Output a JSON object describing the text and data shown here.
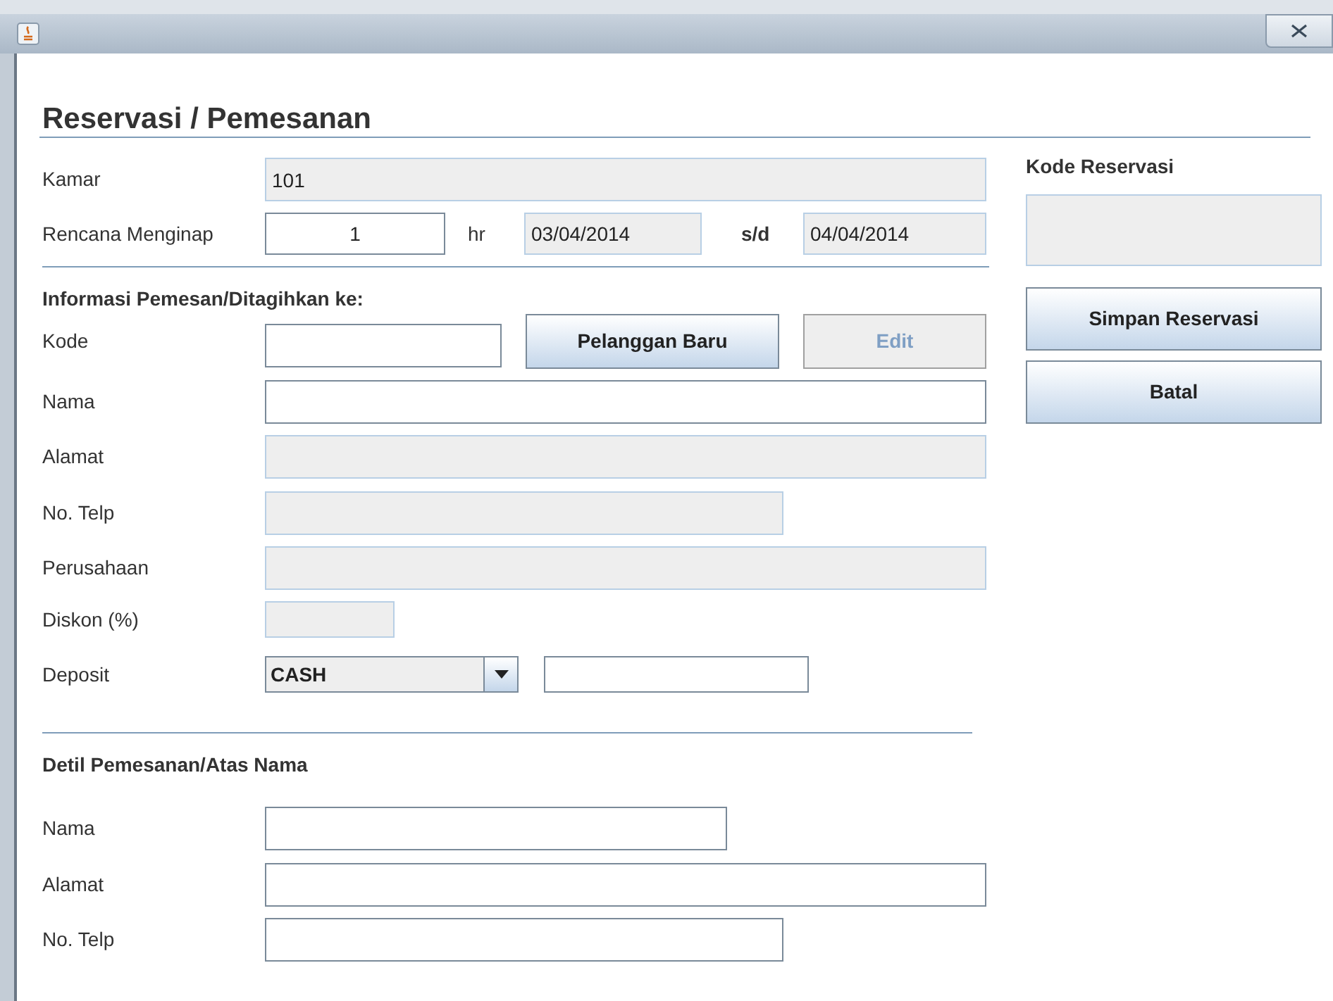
{
  "heading": "Reservasi / Pemesanan",
  "stay": {
    "room_label": "Kamar",
    "room": {
      "value": "101",
      "disabled": true
    },
    "plan_label": "Rencana Menginap",
    "nights": {
      "value": "1",
      "disabled": false
    },
    "unit": "hr",
    "from": {
      "value": "03/04/2014",
      "disabled": true
    },
    "separator": "s/d",
    "to": {
      "value": "04/04/2014",
      "disabled": true
    }
  },
  "billing": {
    "title": "Informasi Pemesan/Ditagihkan ke:",
    "code_label": "Kode",
    "code": {
      "disabled": false
    },
    "buttons": [
      {
        "label": "Pelanggan Baru",
        "disabled": false
      },
      {
        "label": "Edit",
        "disabled": true
      }
    ],
    "rows": [
      {
        "label": "Nama",
        "field": {
          "disabled": false
        }
      },
      {
        "label": "Alamat",
        "field": {
          "disabled": true
        }
      },
      {
        "label": "No. Telp",
        "field": {
          "disabled": true
        }
      },
      {
        "label": "Perusahaan",
        "field": {
          "disabled": true
        }
      },
      {
        "label": "Diskon (%)",
        "field": {
          "disabled": true
        }
      }
    ],
    "deposit_label": "Deposit",
    "deposit_type": "CASH",
    "deposit_amount": {
      "disabled": false
    }
  },
  "guest": {
    "title": "Detil Pemesanan/Atas Nama",
    "rows": [
      {
        "label": "Nama",
        "field": {
          "disabled": false
        }
      },
      {
        "label": "Alamat",
        "field": {
          "disabled": false
        }
      },
      {
        "label": "No. Telp",
        "field": {
          "disabled": false
        }
      }
    ]
  },
  "reservation": {
    "code_label": "Kode Reservasi",
    "code": {
      "disabled": true
    }
  },
  "actions": [
    {
      "label": "Simpan Reservasi"
    },
    {
      "label": "Batal"
    }
  ]
}
